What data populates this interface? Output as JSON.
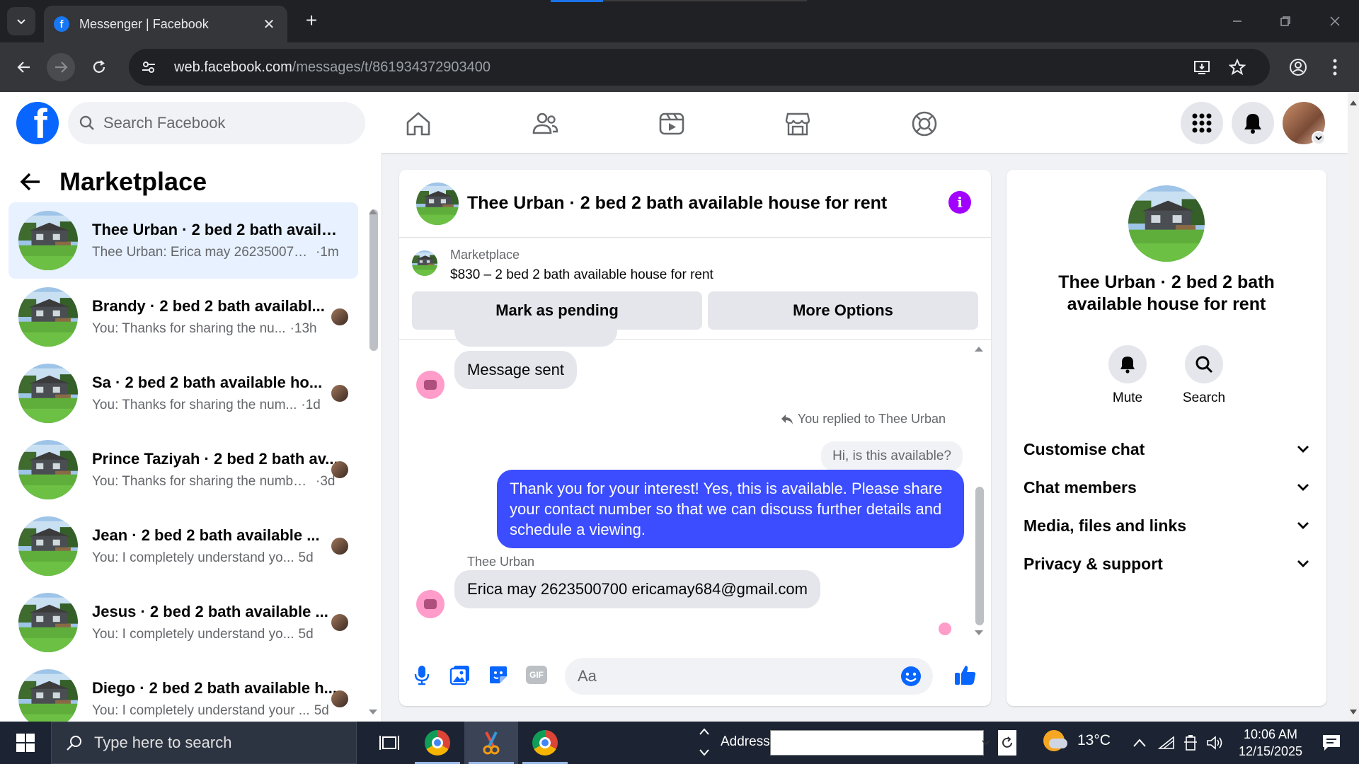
{
  "browser": {
    "tab_title": "Messenger | Facebook",
    "tab_favicon": "f",
    "url_host": "web.facebook.com",
    "url_path": "/messages/t/861934372903400"
  },
  "fb": {
    "search_placeholder": "Search Facebook",
    "logo_letter": "f"
  },
  "sidebar": {
    "title": "Marketplace",
    "conversations": [
      {
        "name": "Thee Urban · 2 bed 2 bath availa...",
        "preview": "Thee Urban: Erica may 262350070...",
        "time": "·1m",
        "active": true
      },
      {
        "name": "Brandy · 2 bed 2 bath availabl...",
        "preview": "You: Thanks for sharing the nu...",
        "time": "·13h",
        "active": false
      },
      {
        "name": "Sa · 2 bed 2 bath available ho...",
        "preview": "You: Thanks for sharing the num...",
        "time": "·1d",
        "active": false
      },
      {
        "name": "Prince Taziyah · 2 bed 2 bath av...",
        "preview": "You: Thanks for sharing the numbe...",
        "time": "·3d",
        "active": false
      },
      {
        "name": "Jean · 2 bed 2 bath available ...",
        "preview": "You: I completely understand yo...",
        "time": "5d",
        "active": false
      },
      {
        "name": "Jesus · 2 bed 2 bath available ...",
        "preview": "You: I completely understand yo...",
        "time": "5d",
        "active": false
      },
      {
        "name": "Diego · 2 bed 2 bath available h...",
        "preview": "You: I completely understand your ...",
        "time": "5d",
        "active": false
      }
    ]
  },
  "chat": {
    "title": "Thee Urban · 2 bed 2 bath available house for rent",
    "listing_label": "Marketplace",
    "listing_price": "$830 – 2 bed 2 bath available house for rent",
    "btn_pending": "Mark as pending",
    "btn_more": "More Options",
    "msg_sent": "Message sent",
    "replied_to": "You replied to Thee Urban",
    "quoted": "Hi, is this available?",
    "outgoing": "Thank you for your interest! Yes, this is available. Please share your contact number so that we can discuss further details and schedule a viewing.",
    "sender": "Thee Urban",
    "incoming": "Erica may 2623500700 ericamay684@gmail.com",
    "composer_placeholder": "Aa",
    "gif_label": "GIF",
    "info_glyph": "i"
  },
  "details": {
    "title": "Thee Urban · 2 bed 2 bath available house for rent",
    "mute": "Mute",
    "search": "Search",
    "sections": [
      "Customise chat",
      "Chat members",
      "Media, files and links",
      "Privacy & support"
    ]
  },
  "taskbar": {
    "search_placeholder": "Type here to search",
    "address_label": "Address",
    "temperature": "13°C",
    "time": "10:06 AM",
    "date": "12/15/2025"
  },
  "colors": {
    "fb_blue": "#0866ff",
    "bubble_out": "#3b4dff",
    "info": "#a200ff"
  }
}
